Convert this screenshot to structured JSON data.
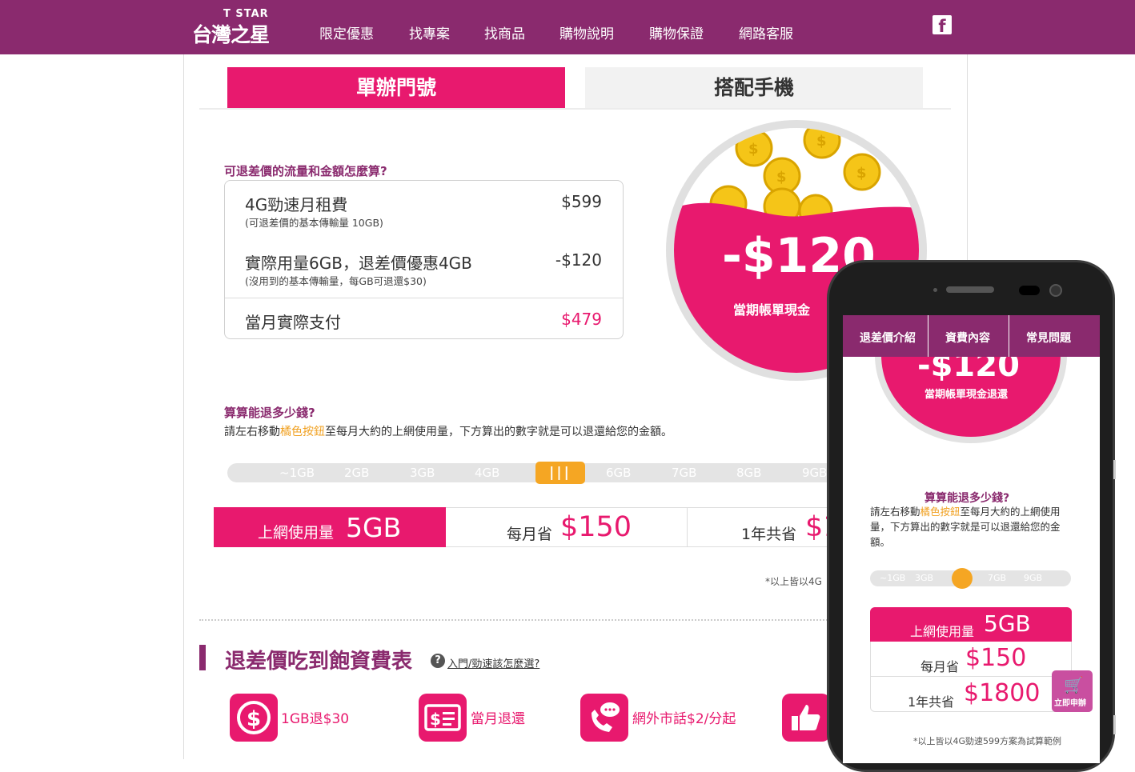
{
  "header": {
    "logo_en": "T STAR",
    "logo_zh": "台灣之星",
    "nav": [
      "限定優惠",
      "找專案",
      "找商品",
      "購物說明",
      "購物保證",
      "網路客服"
    ],
    "facebook": "f"
  },
  "tabs": {
    "single": "單辦門號",
    "with_phone": "搭配手機"
  },
  "calc": {
    "question": "可退差價的流量和金額怎麼算?",
    "rows": [
      {
        "label": "4G勁速月租費",
        "sub": "(可退差價的基本傳輸量 10GB)",
        "value": "$599"
      },
      {
        "label": "實際用量6GB，退差價優惠4GB",
        "sub": "(沒用到的基本傳輸量，每GB可退還$30)",
        "value": "-$120"
      }
    ],
    "total_label": "當月實際支付",
    "total_value": "$479",
    "accent": "#e8196e"
  },
  "circle": {
    "amount": "-$120",
    "caption": "當期帳單現金"
  },
  "slider": {
    "title": "算算能退多少錢?",
    "desc_before": "請左右移動",
    "desc_highlight": "橘色按鈕",
    "desc_after": "至每月大約的上網使用量，下方算出的數字就是可以退還給您的金額。",
    "ticks": [
      "~1GB",
      "2GB",
      "3GB",
      "4GB",
      "6GB",
      "7GB",
      "8GB",
      "9GB"
    ],
    "handle": "|||",
    "selected_gb": 5
  },
  "result": {
    "usage_label": "上網使用量",
    "usage_value": "5GB",
    "month_label": "每月省",
    "month_value": "$150",
    "year_label": "1年共省",
    "year_value": "$1"
  },
  "note": "*以上皆以4G",
  "section": {
    "title": "退差價吃到飽資費表",
    "help_icon": "?",
    "help_link": "入門/勁速該怎麼選?"
  },
  "features": [
    {
      "icon": "dollar-circle-icon",
      "label": "1GB退$30"
    },
    {
      "icon": "bill-icon",
      "label": "當月退還"
    },
    {
      "icon": "phone-chat-icon",
      "label": "網外市話$2/分起"
    },
    {
      "icon": "thumbs-up-icon",
      "label": ""
    }
  ],
  "phone": {
    "tabs": [
      "退差價介紹",
      "資費內容",
      "常見問題"
    ],
    "circle_amount": "-$120",
    "circle_caption": "當期帳單現金退還",
    "calc_title": "算算能退多少錢?",
    "calc_desc_before": "請左右移動",
    "calc_desc_highlight": "橘色按鈕",
    "calc_desc_after": "至每月大約的上網使用量，下方算出的數字就是可以退還給您的金額。",
    "ticks": [
      "~1GB",
      "3GB",
      "7GB",
      "9GB"
    ],
    "usage_label": "上網使用量",
    "usage_value": "5GB",
    "month_label": "每月省",
    "month_value": "$150",
    "year_label": "1年共省",
    "year_value": "$1800",
    "cart_label": "立即申辦",
    "note": "*以上皆以4G勁速599方案為試算範例"
  }
}
